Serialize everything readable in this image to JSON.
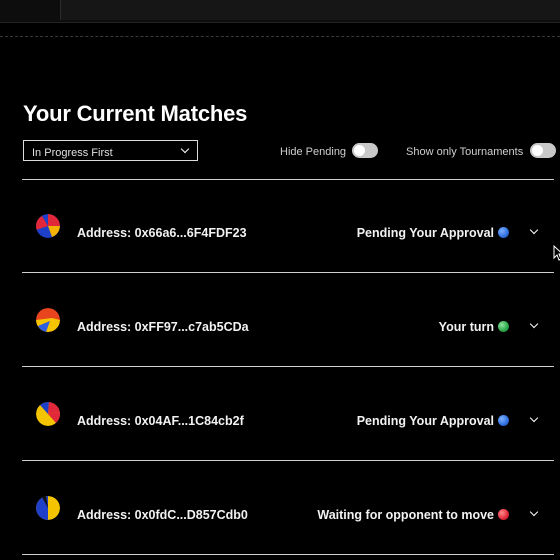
{
  "page": {
    "title": "Your Current Matches"
  },
  "filters": {
    "sort_selected": "In Progress First",
    "hide_pending_label": "Hide Pending",
    "hide_pending_on": false,
    "show_only_tournaments_label": "Show only Tournaments",
    "show_only_tournaments_on": false
  },
  "matches": [
    {
      "address": "Address: 0x66a6...6F4FDF23",
      "status": "Pending Your Approval",
      "status_color": "#2f6fe0",
      "avatar_colors": [
        "#e0283a",
        "#1e3fc8",
        "#f5b300"
      ]
    },
    {
      "address": "Address: 0xFF97...c7ab5CDa",
      "status": "Your turn",
      "status_color": "#2aa84a",
      "avatar_colors": [
        "#e8451f",
        "#f5c400",
        "#2d5de0"
      ]
    },
    {
      "address": "Address: 0x04AF...1C84cb2f",
      "status": "Pending Your Approval",
      "status_color": "#2f6fe0",
      "avatar_colors": [
        "#f5c400",
        "#1e3fc8",
        "#e0283a"
      ]
    },
    {
      "address": "Address: 0x0fdC...D857Cdb0",
      "status": "Waiting for opponent to move",
      "status_color": "#e0283a",
      "avatar_colors": [
        "#1e3fc8",
        "#f5c400",
        "#111111"
      ]
    }
  ],
  "icons": {
    "dropdown": "chevron-down-icon",
    "expand": "chevron-down-icon",
    "cursor": "mouse-pointer-icon"
  }
}
